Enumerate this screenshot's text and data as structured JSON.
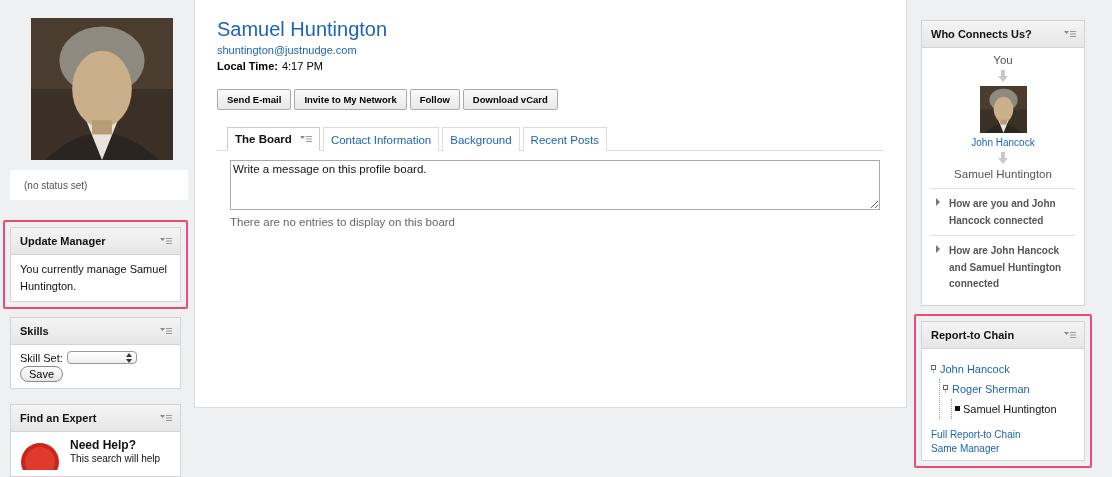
{
  "profile": {
    "name": "Samuel Huntington",
    "email": "shuntington@justnudge.com",
    "local_time_label": "Local Time:",
    "local_time": "4:17 PM",
    "status": "(no status set)"
  },
  "actions": [
    "Send E-mail",
    "Invite to My Network",
    "Follow",
    "Download vCard"
  ],
  "tabs": [
    {
      "label": "The Board",
      "selected": true
    },
    {
      "label": "Contact Information",
      "selected": false
    },
    {
      "label": "Background",
      "selected": false
    },
    {
      "label": "Recent Posts",
      "selected": false
    }
  ],
  "board": {
    "value": "Write a message on this profile board.",
    "empty_message": "There are no entries to display on this board"
  },
  "left_widgets": [
    {
      "kind": "text",
      "title": "Update Manager",
      "highlighted": true,
      "text": "You currently manage Samuel Huntington."
    },
    {
      "kind": "skills",
      "title": "Skills",
      "highlighted": false,
      "field_label": "Skill Set:",
      "button": "Save"
    },
    {
      "kind": "help",
      "title": "Find an Expert",
      "highlighted": false,
      "heading": "Need Help?",
      "text": "This search will help"
    }
  ],
  "right_widgets": [
    {
      "kind": "connections",
      "title": "Who Connects Us?",
      "highlighted": false,
      "path": [
        {
          "kind": "text",
          "label": "You"
        },
        {
          "kind": "person",
          "label": "John Hancock"
        },
        {
          "kind": "text",
          "label": "Samuel Huntington"
        }
      ],
      "questions": [
        {
          "text": "How are you and John Hancock connected",
          "expanded": false
        },
        {
          "text": "How are John Hancock and Samuel Huntington connected",
          "expanded": false
        }
      ]
    },
    {
      "kind": "chain",
      "title": "Report-to Chain",
      "highlighted": true,
      "tree": [
        {
          "label": "John Hancock",
          "children": [
            {
              "label": "Roger Sherman",
              "children": [
                {
                  "label": "Samuel Huntington"
                }
              ]
            }
          ]
        }
      ],
      "links": [
        "Full Report-to Chain",
        "Same Manager"
      ]
    }
  ]
}
